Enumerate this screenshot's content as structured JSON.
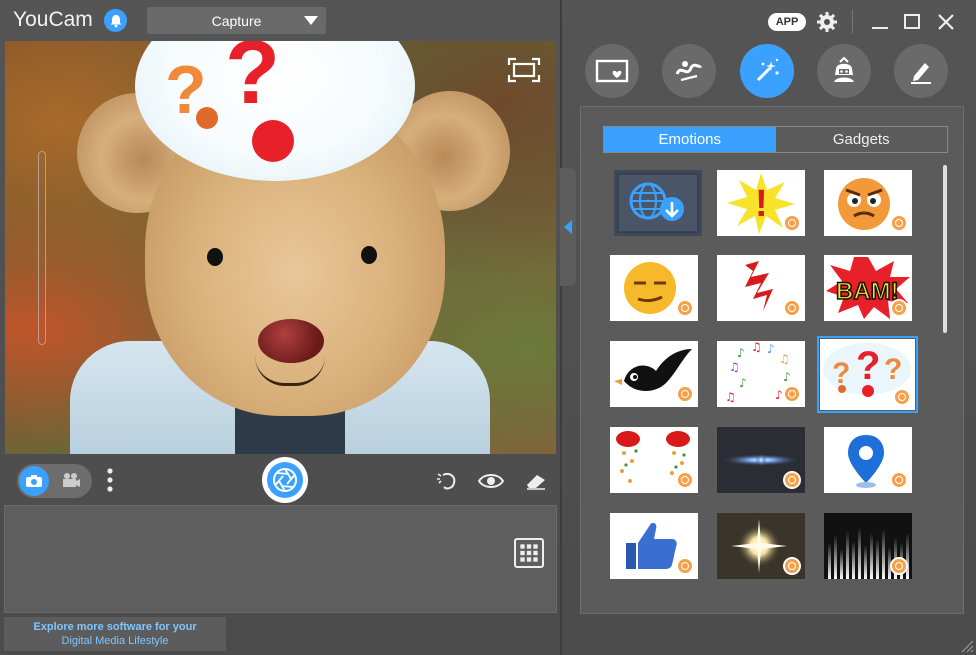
{
  "app": {
    "title": "YouCam"
  },
  "header": {
    "mode": "Capture",
    "app_label": "APP"
  },
  "effects": {
    "tabs": [
      {
        "name": "frames",
        "icon": "frame-heart-icon",
        "active": false
      },
      {
        "name": "distortion",
        "icon": "distortion-icon",
        "active": false
      },
      {
        "name": "magic",
        "icon": "magic-wand-icon",
        "active": true
      },
      {
        "name": "avatar",
        "icon": "avatar-icon",
        "active": false
      },
      {
        "name": "draw",
        "icon": "pen-icon",
        "active": false
      }
    ],
    "segments": {
      "emotions": "Emotions",
      "gadgets": "Gadgets",
      "selected": "Emotions"
    },
    "thumbnails": [
      {
        "icon": "download-more-icon"
      },
      {
        "icon": "exclamation-burst-icon"
      },
      {
        "icon": "angry-face-icon"
      },
      {
        "icon": "sly-face-icon"
      },
      {
        "icon": "zigzag-icon"
      },
      {
        "icon": "bam-icon",
        "text": "BAM!"
      },
      {
        "icon": "bird-icon"
      },
      {
        "icon": "music-notes-icon"
      },
      {
        "icon": "question-marks-icon",
        "selected": true
      },
      {
        "icon": "rose-shower-icon"
      },
      {
        "icon": "lens-flare-icon"
      },
      {
        "icon": "location-pin-icon"
      },
      {
        "icon": "thumbs-up-icon"
      },
      {
        "icon": "sparkle-light-icon"
      },
      {
        "icon": "sound-wave-icon"
      }
    ]
  },
  "promo": {
    "line1": "Explore more software for your",
    "line2": "Digital Media Lifestyle"
  },
  "colors": {
    "accent": "#3ba1ff",
    "badge": "#f5a14a"
  }
}
